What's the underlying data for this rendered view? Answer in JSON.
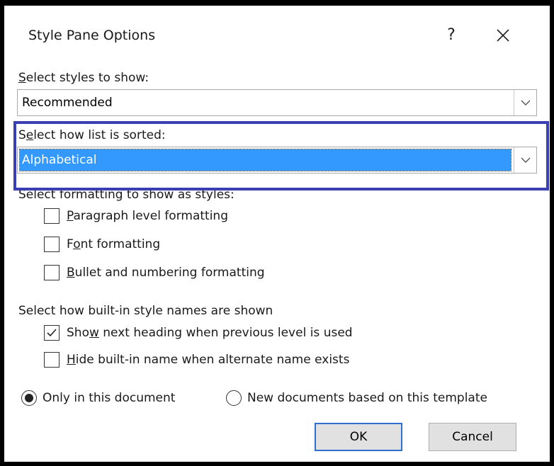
{
  "dialog": {
    "title": "Style Pane Options",
    "help_label": "?",
    "close_icon": "close-icon"
  },
  "styles_to_show": {
    "label_prefix": "",
    "label_accel": "S",
    "label_rest": "elect styles to show:",
    "value": "Recommended"
  },
  "sort_order": {
    "label_prefix": "S",
    "label_accel": "e",
    "label_rest": "lect how list is sorted:",
    "value": "Alphabetical"
  },
  "formatting": {
    "label": "Select formatting to show as styles:",
    "items": [
      {
        "prefix": "",
        "accel": "P",
        "rest": "aragraph level formatting",
        "checked": false
      },
      {
        "prefix": "F",
        "accel": "o",
        "rest": "nt formatting",
        "checked": false
      },
      {
        "prefix": "",
        "accel": "B",
        "rest": "ullet and numbering formatting",
        "checked": false
      }
    ]
  },
  "builtin_names": {
    "label": "Select how built-in style names are shown",
    "items": [
      {
        "prefix": "Sho",
        "accel": "w",
        "rest": " next heading when previous level is used",
        "checked": true
      },
      {
        "prefix": "",
        "accel": "H",
        "rest": "ide built-in name when alternate name exists",
        "checked": false
      }
    ]
  },
  "scope": {
    "option1": "Only in this document",
    "option2": "New documents based on this template",
    "selected": "option1"
  },
  "buttons": {
    "ok": "OK",
    "cancel": "Cancel"
  }
}
